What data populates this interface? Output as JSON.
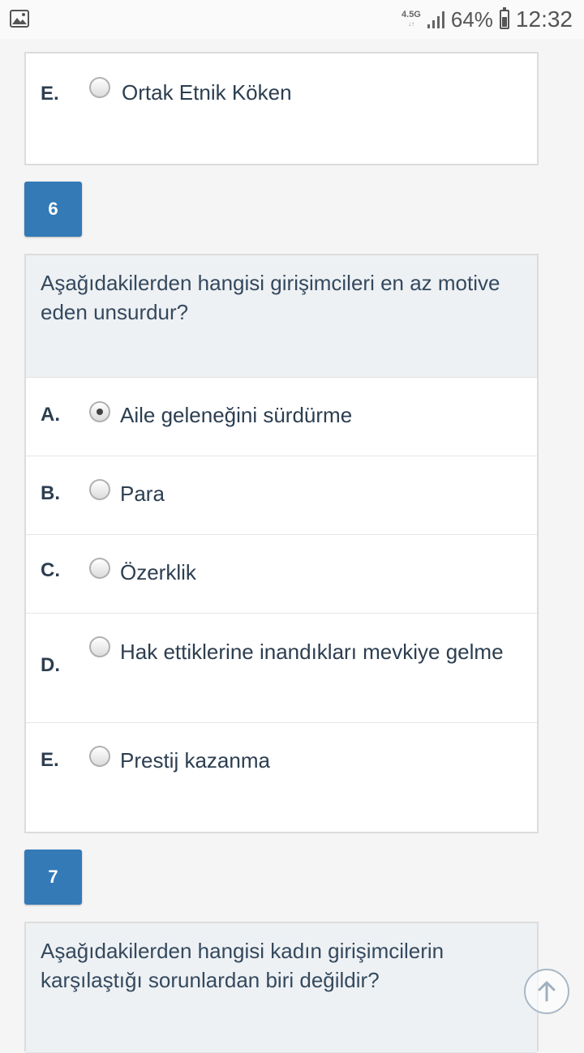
{
  "status_bar": {
    "network": "4.5G",
    "battery": "64%",
    "battery_level": 0.64,
    "time": "12:32",
    "icons": [
      "image-icon",
      "signal-icon",
      "battery-icon"
    ]
  },
  "prev_question": {
    "options": [
      {
        "letter": "E.",
        "text": "Ortak Etnik Köken",
        "selected": false
      }
    ]
  },
  "question6": {
    "number": "6",
    "text": "Aşağıdakilerden hangisi girişimcileri en az motive eden unsurdur?",
    "options": [
      {
        "letter": "A.",
        "text": "Aile geleneğini sürdürme",
        "selected": true
      },
      {
        "letter": "B.",
        "text": "Para",
        "selected": false
      },
      {
        "letter": "C.",
        "text": "Özerklik",
        "selected": false
      },
      {
        "letter": "D.",
        "text": "Hak ettiklerine inandıkları mevkiye gelme",
        "selected": false
      },
      {
        "letter": "E.",
        "text": "Prestij kazanma",
        "selected": false
      }
    ]
  },
  "question7": {
    "number": "7",
    "text": "Aşağıdakilerden hangisi kadın girişimcilerin karşılaştığı sorunlardan biri değildir?"
  },
  "colors": {
    "badge": "#337ab7",
    "question_bg": "#eef1f4",
    "text": "#2c3e50"
  }
}
